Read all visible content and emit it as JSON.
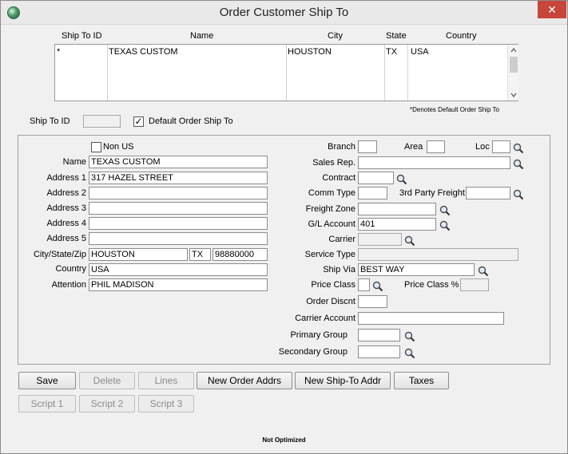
{
  "window": {
    "title": "Order Customer Ship To",
    "close_glyph": "✕",
    "status_text": "Not Optimized"
  },
  "grid": {
    "headers": [
      "Ship To ID",
      "Name",
      "City",
      "State",
      "Country"
    ],
    "rows": [
      {
        "ship_to_id": "*",
        "name": "TEXAS CUSTOM",
        "city": "HOUSTON",
        "state": "TX",
        "country": "USA"
      }
    ],
    "footnote": "*Denotes Default Order Ship To"
  },
  "ship_to": {
    "id_label": "Ship To ID",
    "id_value": "",
    "default_label": "Default Order Ship To",
    "default_checked": true
  },
  "left_form": {
    "non_us_label": "Non US",
    "non_us_checked": false,
    "name_label": "Name",
    "name_value": "TEXAS CUSTOM",
    "address1_label": "Address 1",
    "address1_value": "317 HAZEL STREET",
    "address2_label": "Address 2",
    "address2_value": "",
    "address3_label": "Address 3",
    "address3_value": "",
    "address4_label": "Address 4",
    "address4_value": "",
    "address5_label": "Address 5",
    "address5_value": "",
    "csz_label": "City/State/Zip",
    "city_value": "HOUSTON",
    "state_value": "TX",
    "zip_value": "98880000",
    "country_label": "Country",
    "country_value": "USA",
    "attention_label": "Attention",
    "attention_value": "PHIL MADISON"
  },
  "right_form": {
    "branch_label": "Branch",
    "branch_value": "",
    "area_label": "Area",
    "area_value": "",
    "loc_label": "Loc",
    "loc_value": "",
    "sales_rep_label": "Sales Rep.",
    "sales_rep_value": "",
    "contract_label": "Contract",
    "contract_value": "",
    "comm_type_label": "Comm Type",
    "comm_type_value": "",
    "third_party_label": "3rd Party Freight",
    "third_party_value": "",
    "freight_zone_label": "Freight Zone",
    "freight_zone_value": "",
    "gl_account_label": "G/L Account",
    "gl_account_value": "401",
    "carrier_label": "Carrier",
    "carrier_value": "",
    "service_type_label": "Service Type",
    "service_type_value": "",
    "ship_via_label": "Ship Via",
    "ship_via_value": "BEST WAY",
    "price_class_label": "Price Class",
    "price_class_value": "",
    "price_class_pct_label": "Price Class %",
    "price_class_pct_value": "",
    "order_discnt_label": "Order Discnt",
    "order_discnt_value": "",
    "carrier_account_label": "Carrier Account",
    "carrier_account_value": "",
    "primary_group_label": "Primary Group",
    "primary_group_value": "",
    "secondary_group_label": "Secondary Group",
    "secondary_group_value": ""
  },
  "buttons": {
    "save": "Save",
    "delete": "Delete",
    "lines": "Lines",
    "new_order_addrs": "New Order Addrs",
    "new_ship_to_addr": "New Ship-To Addr",
    "taxes": "Taxes",
    "script1": "Script 1",
    "script2": "Script 2",
    "script3": "Script 3"
  },
  "icons": {
    "lookup": "magnifier-icon",
    "app": "app-globe-icon"
  }
}
